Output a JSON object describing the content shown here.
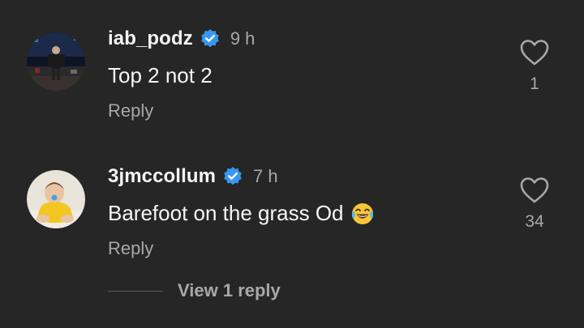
{
  "comments": [
    {
      "username": "iab_podz",
      "verified": true,
      "time": "9 h",
      "text": "Top 2 not 2",
      "reply_label": "Reply",
      "like_count": "1",
      "avatar_icon": "stage-performer-avatar"
    },
    {
      "username": "3jmccollum",
      "verified": true,
      "time": "7 h",
      "text": "Barefoot on the grass Od",
      "emoji": "face-with-tears-of-joy",
      "reply_label": "Reply",
      "like_count": "34",
      "avatar_icon": "baby-yellow-outfit-avatar",
      "view_replies_label": "View 1 reply"
    }
  ],
  "colors": {
    "background": "#262626",
    "primary_text": "#f5f5f5",
    "secondary_text": "#a8a8a8",
    "verified_badge": "#3897f0"
  }
}
